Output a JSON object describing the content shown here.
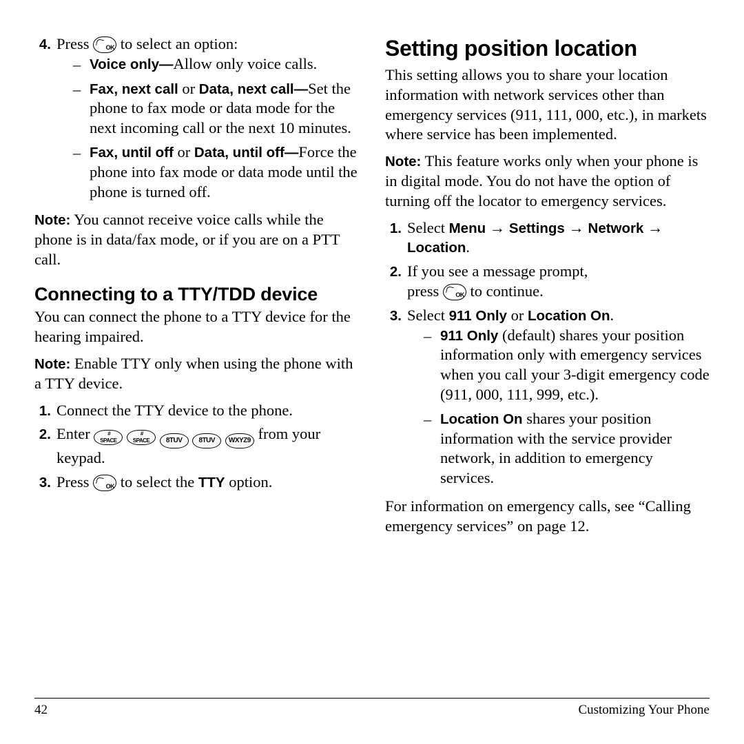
{
  "left": {
    "step4": {
      "num": "4.",
      "lead_a": "Press",
      "lead_b": "to select an option:",
      "opts": [
        {
          "bold": "Voice only—",
          "rest": "Allow only voice calls."
        },
        {
          "bold": "Fax, next call",
          "mid": " or ",
          "bold2": "Data, next call—",
          "rest": "Set the phone to fax mode or data mode for the next incoming call or the next 10 minutes."
        },
        {
          "bold": "Fax, until off",
          "mid": " or ",
          "bold2": "Data, until off—",
          "rest": "Force the phone into fax mode or data mode until the phone is turned off."
        }
      ]
    },
    "note1_label": "Note:",
    "note1_text": "  You cannot receive voice calls while the phone is in data/fax mode, or if you are on a PTT call.",
    "tty_heading": "Connecting to a TTY/TDD device",
    "tty_intro": "You can connect the phone to a TTY device for the hearing impaired.",
    "note2_label": "Note:",
    "note2_text": "  Enable TTY only when using the phone with a TTY device.",
    "tty_steps": {
      "s1": {
        "num": "1.",
        "text": "Connect the TTY device to the phone."
      },
      "s2": {
        "num": "2.",
        "lead": "Enter",
        "keys": [
          "#",
          "#",
          "8TUV",
          "8TUV",
          "WXYZ9"
        ],
        "tail": "from your keypad."
      },
      "s3": {
        "num": "3.",
        "lead_a": "Press",
        "lead_b": "to select the",
        "bold": "TTY",
        "lead_c": "option."
      }
    }
  },
  "right": {
    "chapter": "Setting position location",
    "intro": "This setting allows you to share your location information with network services other than emergency services (911, 111, 000, etc.), in markets where service has been implemented.",
    "note_label": "Note:",
    "note_text": "  This feature works only when your phone is in digital mode. You do not have the option of turning off the locator to emergency services.",
    "steps": {
      "s1": {
        "num": "1.",
        "lead": "Select ",
        "path": [
          "Menu",
          "Settings",
          "Network",
          "Location"
        ]
      },
      "s2": {
        "num": "2.",
        "line1": "If you see a message prompt,",
        "line2a": "press",
        "line2b": "to continue."
      },
      "s3": {
        "num": "3.",
        "lead": "Select ",
        "opt_a": "911 Only",
        "or": " or ",
        "opt_b": "Location On",
        "period": ".",
        "subs": [
          {
            "bold": "911 Only",
            "rest": " (default) shares your position information only with emergency services when you call your 3-digit emergency code (911, 000, 111, 999, etc.)."
          },
          {
            "bold": "Location On",
            "rest": " shares your position information with the service provider network, in addition to emergency services."
          }
        ]
      }
    },
    "outro": "For information on emergency calls, see “Calling emergency services” on page 12."
  },
  "footer": {
    "page_num": "42",
    "section": "Customizing Your Phone"
  }
}
